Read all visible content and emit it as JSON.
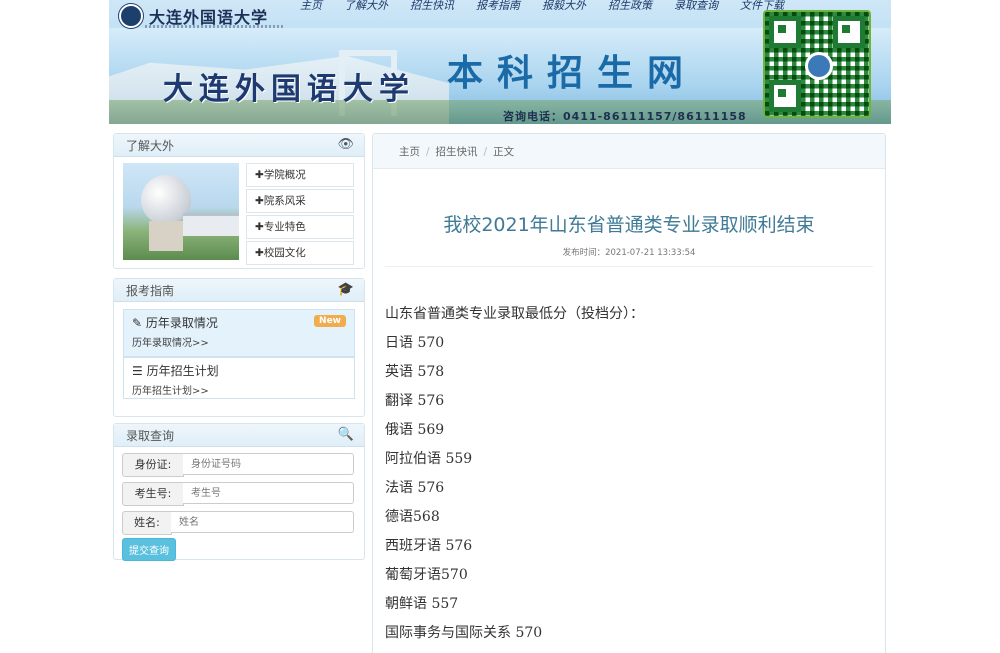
{
  "header": {
    "logo_text": "大连外国语大学",
    "nav": [
      "主页",
      "了解大外",
      "招生快讯",
      "报考指南",
      "报毅大外",
      "招生政策",
      "录取查询",
      "文件下载"
    ],
    "campus_name": "大连外国语大学",
    "site_title": "本科招生网",
    "phone": "咨询电话：0411-86111157/86111158"
  },
  "panel_about": {
    "title": "了解大外",
    "icon": "eye-icon",
    "links": [
      "学院概况",
      "院系风采",
      "专业特色",
      "校园文化"
    ]
  },
  "panel_guide": {
    "title": "报考指南",
    "icon": "graduation-cap-icon",
    "items": [
      {
        "title": "历年录取情况",
        "sub": "历年录取情况>>",
        "badge": "New"
      },
      {
        "title": "历年招生计划",
        "sub": "历年招生计划>>"
      }
    ]
  },
  "panel_query": {
    "title": "录取查询",
    "icon": "search-icon",
    "fields": [
      {
        "label": "身份证:",
        "placeholder": "身份证号码"
      },
      {
        "label": "考生号:",
        "placeholder": "考生号"
      },
      {
        "label": "姓名:",
        "placeholder": "姓名"
      }
    ],
    "submit": "提交查询"
  },
  "article": {
    "breadcrumb": [
      "主页",
      "招生快讯",
      "正文"
    ],
    "title": "我校2021年山东省普通类专业录取顺利结束",
    "meta": "发布时间：2021-07-21 13:33:54",
    "lines": [
      "山东省普通类专业录取最低分（投档分）：",
      "日语 570",
      "英语 578",
      "翻译 576",
      "俄语 569",
      "阿拉伯语 559",
      "法语 576",
      "德语568",
      "西班牙语 576",
      "葡萄牙语570",
      "朝鲜语 557",
      "国际事务与国际关系 570"
    ]
  }
}
